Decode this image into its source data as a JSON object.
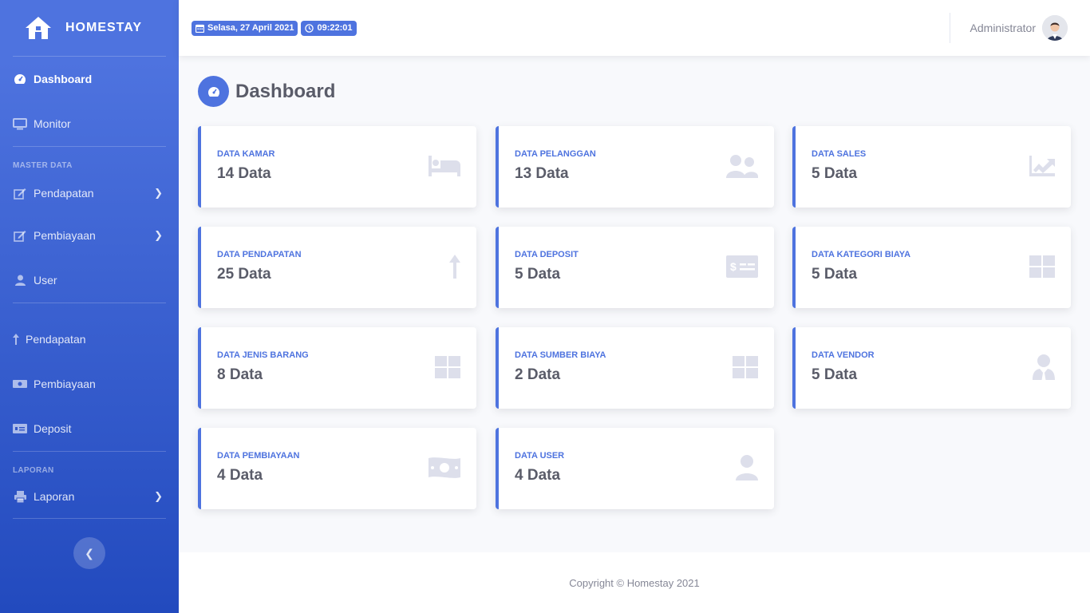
{
  "brand": {
    "name": "HOMESTAY"
  },
  "sidebar": {
    "items": [
      {
        "label": "Dashboard",
        "icon": "tachometer-icon"
      },
      {
        "label": "Monitor",
        "icon": "desktop-icon"
      }
    ],
    "master_heading": "MASTER DATA",
    "master_items": [
      {
        "label": "Pendapatan",
        "icon": "edit-icon"
      },
      {
        "label": "Pembiayaan",
        "icon": "edit-icon"
      },
      {
        "label": "User",
        "icon": "user-icon"
      }
    ],
    "tx_items": [
      {
        "label": "Pendapatan",
        "icon": "arrow-up-icon"
      },
      {
        "label": "Pembiayaan",
        "icon": "money-icon"
      },
      {
        "label": "Deposit",
        "icon": "money-check-icon"
      }
    ],
    "report_heading": "LAPORAN",
    "report_items": [
      {
        "label": "Laporan",
        "icon": "print-icon"
      }
    ]
  },
  "topbar": {
    "date": "Selasa, 27 April 2021",
    "time": "09:22:01",
    "user": "Administrator"
  },
  "page": {
    "title": "Dashboard"
  },
  "cards": [
    {
      "label": "DATA KAMAR",
      "value": "14 Data",
      "icon": "bed-icon"
    },
    {
      "label": "DATA PELANGGAN",
      "value": "13 Data",
      "icon": "users-icon"
    },
    {
      "label": "DATA SALES",
      "value": "5 Data",
      "icon": "chart-line-icon"
    },
    {
      "label": "DATA PENDAPATAN",
      "value": "25 Data",
      "icon": "arrow-up-icon"
    },
    {
      "label": "DATA DEPOSIT",
      "value": "5 Data",
      "icon": "money-check-icon"
    },
    {
      "label": "DATA KATEGORI BIAYA",
      "value": "5 Data",
      "icon": "grid-icon"
    },
    {
      "label": "DATA JENIS BARANG",
      "value": "8 Data",
      "icon": "grid-icon"
    },
    {
      "label": "DATA SUMBER BIAYA",
      "value": "2 Data",
      "icon": "grid-icon"
    },
    {
      "label": "DATA VENDOR",
      "value": "5 Data",
      "icon": "user-tie-icon"
    },
    {
      "label": "DATA PEMBIAYAAN",
      "value": "4 Data",
      "icon": "money-bill-icon"
    },
    {
      "label": "DATA USER",
      "value": "4 Data",
      "icon": "user-icon"
    }
  ],
  "footer": {
    "text": "Copyright © Homestay 2021"
  },
  "colors": {
    "primary": "#4e73df",
    "primary_dark": "#224abe",
    "text": "#5a5c69",
    "muted": "#858796",
    "icon_muted": "#dddfeb"
  }
}
